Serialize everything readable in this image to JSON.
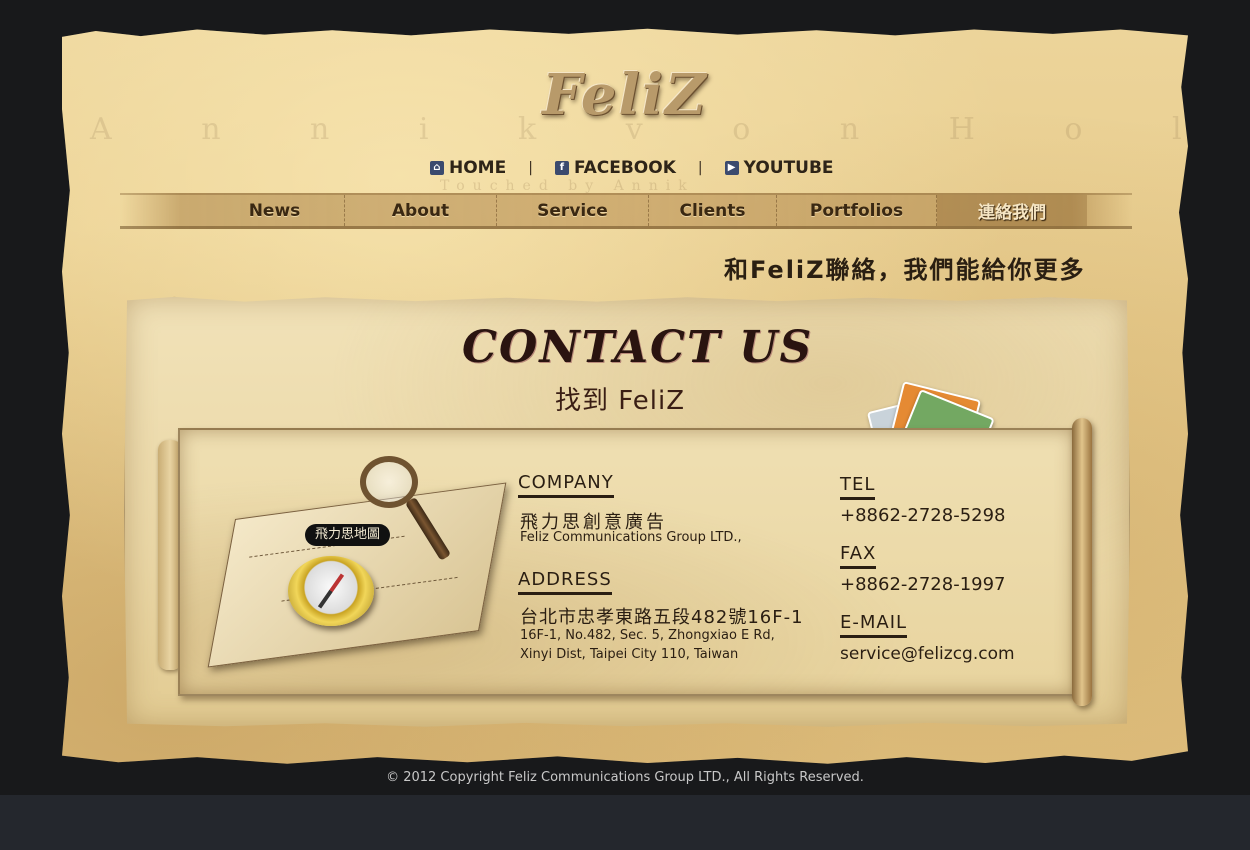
{
  "logo": {
    "text": "FeliZ"
  },
  "watermark": {
    "name": "A n n i k   v o n   H o l d t",
    "sub": "Touched by Annik"
  },
  "top_links": [
    {
      "label": "HOME",
      "icon": "home-icon"
    },
    {
      "label": "FACEBOOK",
      "icon": "facebook-icon"
    },
    {
      "label": "YOUTUBE",
      "icon": "youtube-icon"
    }
  ],
  "top_links_separator": "|",
  "nav": [
    {
      "label": "News"
    },
    {
      "label": "About"
    },
    {
      "label": "Service"
    },
    {
      "label": "Clients"
    },
    {
      "label": "Portfolios"
    },
    {
      "label": "連絡我們",
      "active": true
    }
  ],
  "tagline": "和FeliZ聯絡，我們能給你更多",
  "contact": {
    "title": "CONTACT US",
    "subtitle": "找到 FeliZ",
    "map_tag": "飛力思地圖",
    "company_heading": "COMPANY",
    "company_zh": "飛力思創意廣告",
    "company_en": "Feliz Communications Group LTD.,",
    "address_heading": "ADDRESS",
    "address_zh": "台北市忠孝東路五段482號16F-1",
    "address_en_1": "16F-1, No.482, Sec. 5, Zhongxiao E Rd,",
    "address_en_2": "Xinyi Dist, Taipei City 110, Taiwan",
    "tel_heading": "TEL",
    "tel": "+8862-2728-5298",
    "fax_heading": "FAX",
    "fax": "+8862-2728-1997",
    "email_heading": "E-MAIL",
    "email": "service@felizcg.com"
  },
  "footer": {
    "copyright": "© 2012 Copyright Feliz Communications Group LTD., All Rights Reserved."
  },
  "colors": {
    "background": "#18191b",
    "parchment": "#e8cc8c",
    "ink": "#2a1e12",
    "footer_band": "#24272d"
  }
}
